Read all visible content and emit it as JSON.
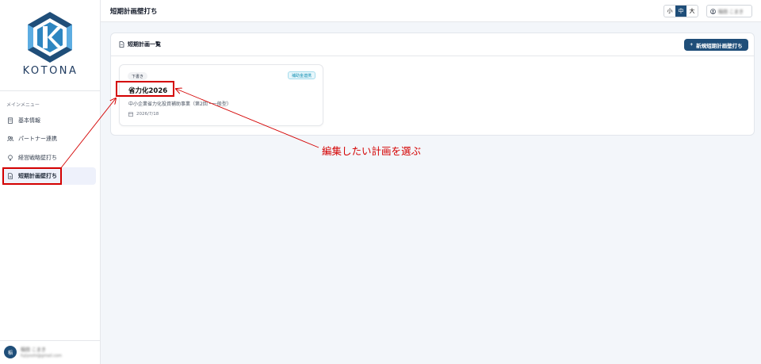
{
  "brand": {
    "name": "KOTONA",
    "logo_colors": [
      "#1f4e79",
      "#2e86c1",
      "#5dade2"
    ]
  },
  "sidebar": {
    "section_title": "メインメニュー",
    "items": [
      {
        "label": "基本情報",
        "icon": "building-icon"
      },
      {
        "label": "パートナー連携",
        "icon": "users-icon"
      },
      {
        "label": "経営戦略壁打ち",
        "icon": "lightbulb-icon"
      },
      {
        "label": "短期計画壁打ち",
        "icon": "document-icon",
        "active": true
      }
    ],
    "user": {
      "initial": "稲",
      "name": "稲田 こまき",
      "email": "fujiyoshi@gmail.com"
    }
  },
  "header": {
    "title": "短期計画壁打ち",
    "size_options": [
      "小",
      "中",
      "大"
    ],
    "size_selected": "中",
    "account_name": "稲田 こまき"
  },
  "panel": {
    "title": "短期計画一覧",
    "new_button": "新規短期計画壁打ち",
    "cards": [
      {
        "status": "下書き",
        "badge": "補助金連携",
        "name": "省力化2026",
        "subtitle": "中小企業省力化投資補助事業（第2回・一般型）",
        "date": "2026/7/18"
      }
    ]
  },
  "annotation": {
    "text": "編集したい計画を選ぶ",
    "color": "#d40000"
  }
}
